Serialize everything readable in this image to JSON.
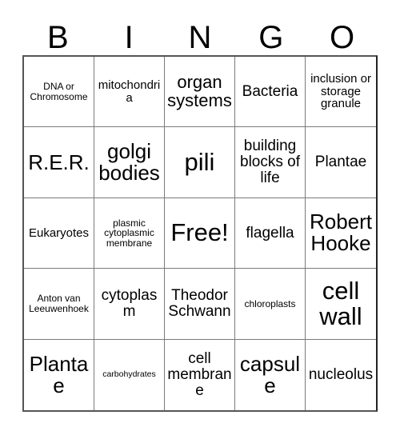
{
  "card": {
    "header_letters": [
      "B",
      "I",
      "N",
      "G",
      "O"
    ],
    "free_space_label": "Free!",
    "rows": [
      [
        {
          "text": "DNA or Chromosome",
          "size": "xs"
        },
        {
          "text": "mitochondria",
          "size": "sm"
        },
        {
          "text": "organ systems",
          "size": "lg"
        },
        {
          "text": "Bacteria",
          "size": "md"
        },
        {
          "text": "inclusion or storage granule",
          "size": "sm"
        }
      ],
      [
        {
          "text": "R.E.R.",
          "size": "xl"
        },
        {
          "text": "golgi bodies",
          "size": "xl"
        },
        {
          "text": "pili",
          "size": "xxl"
        },
        {
          "text": "building blocks of life",
          "size": "md"
        },
        {
          "text": "Plantae",
          "size": "md"
        }
      ],
      [
        {
          "text": "Eukaryotes",
          "size": "sm"
        },
        {
          "text": "plasmic cytoplasmic membrane",
          "size": "xs"
        },
        {
          "text": "Free!",
          "size": "xxl"
        },
        {
          "text": "flagella",
          "size": "md"
        },
        {
          "text": "Robert Hooke",
          "size": "xl"
        }
      ],
      [
        {
          "text": "Anton van Leeuwenhoek",
          "size": "xs"
        },
        {
          "text": "cytoplasm",
          "size": "md"
        },
        {
          "text": "Theodor Schwann",
          "size": "md"
        },
        {
          "text": "chloroplasts",
          "size": "xs"
        },
        {
          "text": "cell wall",
          "size": "xxl"
        }
      ],
      [
        {
          "text": "Plantae",
          "size": "xl"
        },
        {
          "text": "carbohydrates",
          "size": "xxs"
        },
        {
          "text": "cell membrane",
          "size": "md"
        },
        {
          "text": "capsule",
          "size": "xl"
        },
        {
          "text": "nucleolus",
          "size": "md"
        }
      ]
    ]
  },
  "colors": {
    "background": "#ffffff",
    "text": "#000000",
    "grid_line": "#7a7a7a",
    "grid_border": "#555555"
  }
}
